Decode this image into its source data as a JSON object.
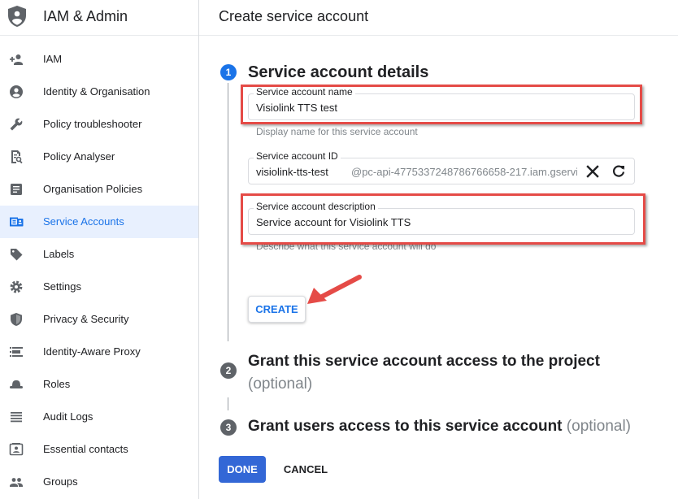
{
  "sidebar": {
    "title": "IAM & Admin",
    "logo_icon": "shield-icon",
    "items": [
      {
        "label": "IAM",
        "icon": "person-add-icon",
        "active": false
      },
      {
        "label": "Identity & Organisation",
        "icon": "account-circle-icon",
        "active": false
      },
      {
        "label": "Policy troubleshooter",
        "icon": "wrench-icon",
        "active": false
      },
      {
        "label": "Policy Analyser",
        "icon": "document-search-icon",
        "active": false
      },
      {
        "label": "Organisation Policies",
        "icon": "list-document-icon",
        "active": false
      },
      {
        "label": "Service Accounts",
        "icon": "service-account-icon",
        "active": true
      },
      {
        "label": "Labels",
        "icon": "tag-icon",
        "active": false
      },
      {
        "label": "Settings",
        "icon": "gear-icon",
        "active": false
      },
      {
        "label": "Privacy & Security",
        "icon": "shield-lock-icon",
        "active": false
      },
      {
        "label": "Identity-Aware Proxy",
        "icon": "proxy-icon",
        "active": false
      },
      {
        "label": "Roles",
        "icon": "hat-icon",
        "active": false
      },
      {
        "label": "Audit Logs",
        "icon": "lines-icon",
        "active": false
      },
      {
        "label": "Essential contacts",
        "icon": "contact-card-icon",
        "active": false
      },
      {
        "label": "Groups",
        "icon": "group-icon",
        "active": false
      }
    ]
  },
  "header": {
    "title": "Create service account"
  },
  "steps": {
    "step1": {
      "number": "1",
      "title": "Service account details"
    },
    "step2": {
      "number": "2",
      "title": "Grant this service account access to the project",
      "optional": "(optional)"
    },
    "step3": {
      "number": "3",
      "title": "Grant users access to this service account",
      "optional": "(optional)"
    }
  },
  "form": {
    "name": {
      "label": "Service account name",
      "value": "Visiolink TTS test",
      "helper": "Display name for this service account"
    },
    "id": {
      "label": "Service account ID",
      "value": "visiolink-tts-test",
      "suffix": "@pc-api-4775337248786766658-217.iam.gservi",
      "clear_icon": "close-icon",
      "refresh_icon": "refresh-icon"
    },
    "description": {
      "label": "Service account description",
      "value": "Service account for Visiolink TTS",
      "helper": "Describe what this service account will do"
    }
  },
  "buttons": {
    "create": "CREATE",
    "done": "DONE",
    "cancel": "CANCEL"
  },
  "colors": {
    "accent": "#1a73e8",
    "done_button": "#3367d6",
    "highlight": "#e54b47",
    "active_nav_bg": "#e8f0fe"
  }
}
